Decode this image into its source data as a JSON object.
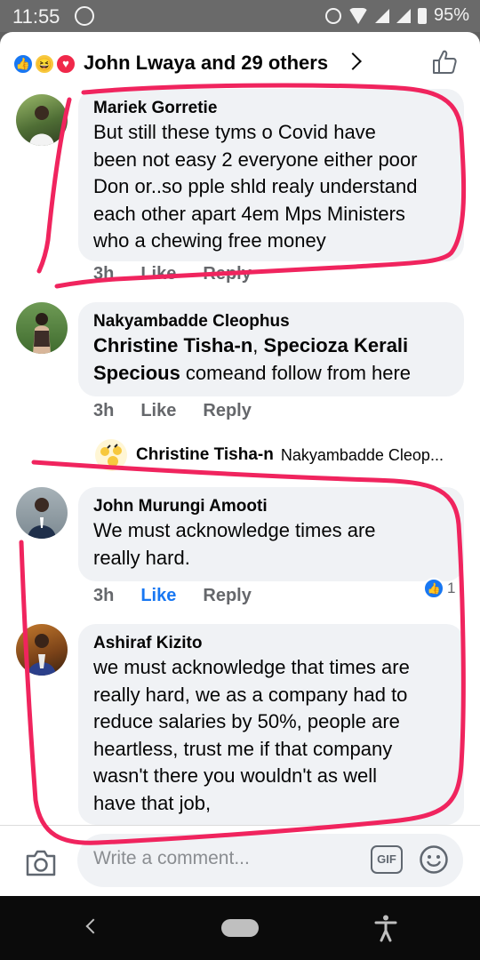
{
  "status_bar": {
    "time": "11:55",
    "battery": "95%"
  },
  "reactions": {
    "summary": "John Lwaya and 29 others"
  },
  "comments": [
    {
      "author": "Mariek Gorretie",
      "lines": [
        "But still these tyms o Covid have",
        "been not easy 2 everyone either poor",
        "Don or..so pple shld realy understand",
        "each other apart 4em Mps Ministers",
        "who a chewing free money"
      ],
      "time": "3h",
      "like": "Like",
      "reply": "Reply"
    },
    {
      "author": "Nakyambadde Cleophus",
      "mention1": "Christine Tisha-n",
      "sep": ", ",
      "mention2a": "Specioza Kerali",
      "mention2b": "Specious",
      "after": " comeand follow from here",
      "time": "3h",
      "like": "Like",
      "reply": "Reply"
    },
    {
      "author": "John Murungi Amooti",
      "lines": [
        "We must acknowledge times are",
        "really hard."
      ],
      "time": "3h",
      "like": "Like",
      "reply": "Reply",
      "reaction_count": "1"
    },
    {
      "author": "Ashiraf Kizito",
      "lines": [
        "we must acknowledge that times are",
        "really hard, we as a company had to",
        "reduce salaries by 50%, people are",
        "heartless, trust me if that company",
        "wasn't there you wouldn't as well",
        "have that job,"
      ]
    }
  ],
  "reply_preview": {
    "author": "Christine Tisha-n",
    "snippet": "Nakyambadde Cleop..."
  },
  "composer": {
    "placeholder": "Write a comment...",
    "gif_label": "GIF"
  },
  "colors": {
    "accent": "#1877f2",
    "annotation": "#f0245e",
    "bubble": "#f0f2f5"
  }
}
